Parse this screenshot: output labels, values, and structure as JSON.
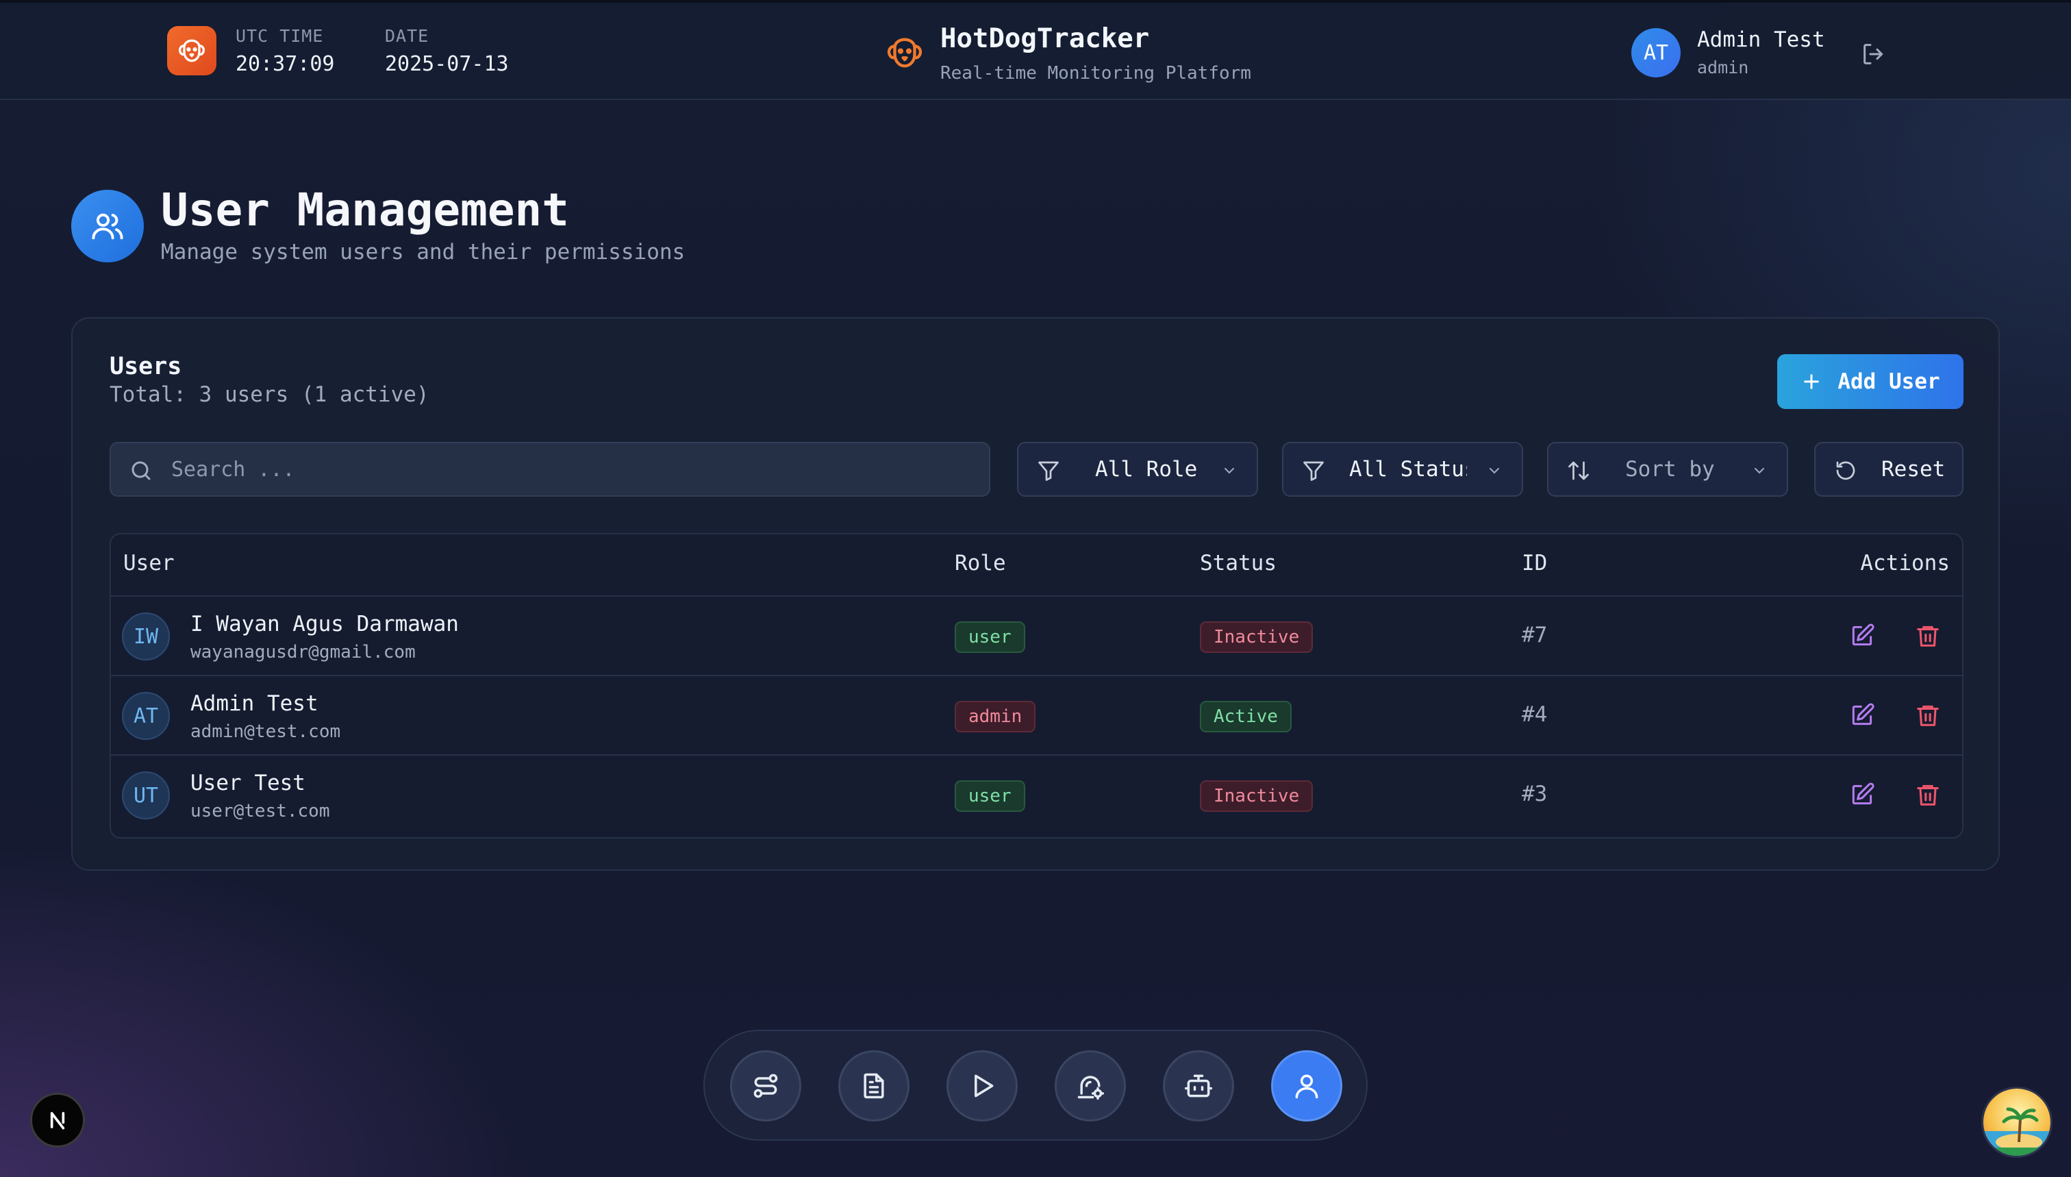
{
  "header": {
    "utc_label": "UTC TIME",
    "utc_value": "20:37:09",
    "date_label": "DATE",
    "date_value": "2025-07-13",
    "brand_title": "HotDogTracker",
    "brand_subtitle": "Real-time Monitoring Platform",
    "user_initials": "AT",
    "user_name": "Admin Test",
    "user_role": "admin",
    "icons": [
      "dog-logo-icon",
      "dog-brand-icon",
      "logout-icon"
    ]
  },
  "page": {
    "title": "User Management",
    "subtitle": "Manage system users and their permissions",
    "icon": "users-icon"
  },
  "card": {
    "title": "Users",
    "subtitle": "Total: 3 users (1 active)",
    "add_button": "Add User"
  },
  "filters": {
    "search_placeholder": "Search ...",
    "role": "All Role",
    "status": "All Status",
    "sort": "Sort by",
    "reset": "Reset"
  },
  "table": {
    "columns": [
      "User",
      "Role",
      "Status",
      "ID",
      "Actions"
    ],
    "rows": [
      {
        "initials": "IW",
        "name": "I Wayan Agus Darmawan",
        "email": "wayanagusdr@gmail.com",
        "role": "user",
        "status": "Inactive",
        "id": "#7"
      },
      {
        "initials": "AT",
        "name": "Admin Test",
        "email": "admin@test.com",
        "role": "admin",
        "status": "Active",
        "id": "#4"
      },
      {
        "initials": "UT",
        "name": "User Test",
        "email": "user@test.com",
        "role": "user",
        "status": "Inactive",
        "id": "#3"
      }
    ]
  },
  "dock": {
    "items": [
      "route-icon",
      "document-icon",
      "play-icon",
      "alarm-icon",
      "bot-icon",
      "user-icon"
    ],
    "active": "user-icon"
  },
  "colors": {
    "accent": "#3b7cf2",
    "brand_orange": "#f06b2b",
    "active_green": "#7fe0a6",
    "inactive_red": "#f08a9d",
    "edit_purple": "#b57cf0",
    "delete_red": "#f0566b"
  }
}
